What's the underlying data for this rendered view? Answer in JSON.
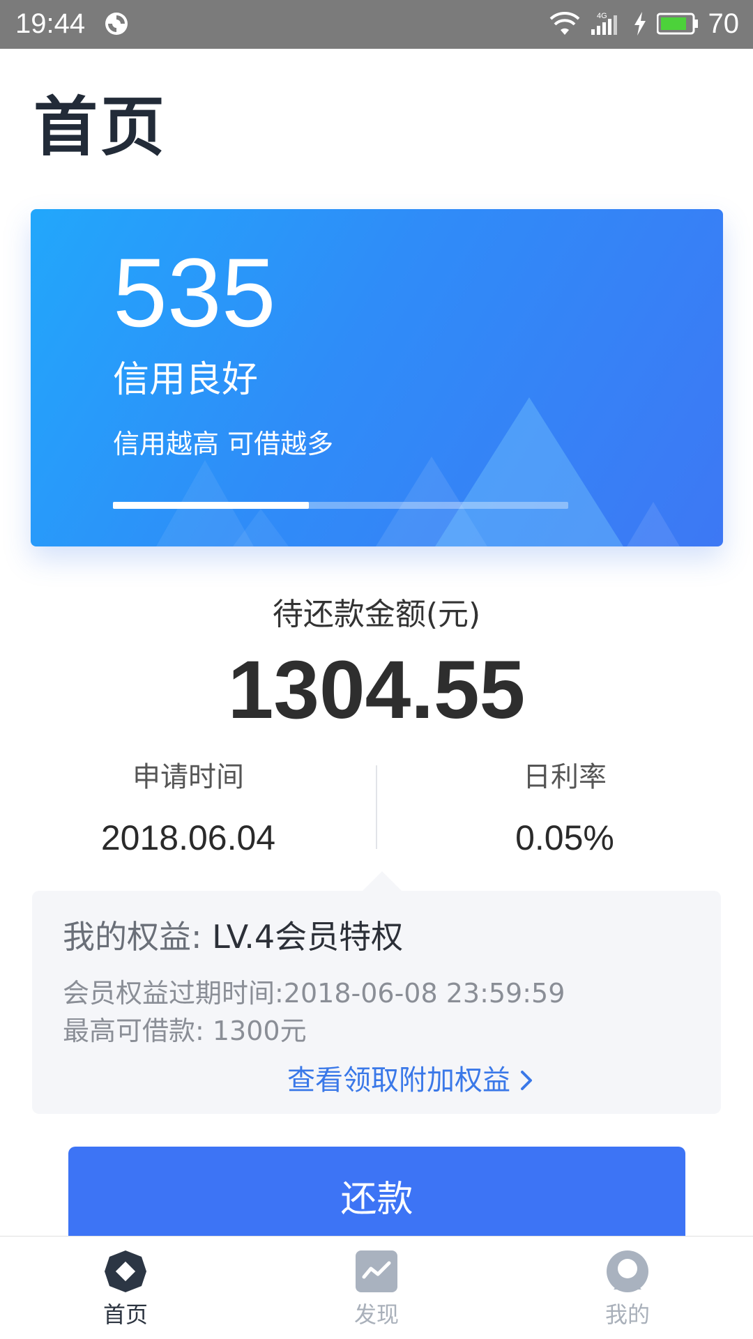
{
  "status_bar": {
    "time": "19:44",
    "network": "4G",
    "battery": "70",
    "icons": [
      "sync-icon",
      "wifi-icon",
      "signal-icon",
      "charging-icon",
      "battery-icon"
    ]
  },
  "page": {
    "title": "首页"
  },
  "credit": {
    "score": "535",
    "level": "信用良好",
    "tip": "信用越高 可借越多",
    "progress_fraction": 0.43
  },
  "repayment": {
    "label": "待还款金额(元)",
    "amount": "1304.55",
    "apply_time_label": "申请时间",
    "apply_time": "2018.06.04",
    "daily_rate_label": "日利率",
    "daily_rate": "0.05%"
  },
  "benefits": {
    "title_key": "我的权益:",
    "title_value": "LV.4会员特权",
    "expiry": "会员权益过期时间:2018-06-08 23:59:59",
    "max_loan": "最高可借款: 1300元",
    "link": "查看领取附加权益"
  },
  "actions": {
    "repay": "还款"
  },
  "tabbar": {
    "items": [
      {
        "label": "首页",
        "icon": "home-icon",
        "active": true
      },
      {
        "label": "发现",
        "icon": "discover-icon",
        "active": false
      },
      {
        "label": "我的",
        "icon": "profile-icon",
        "active": false
      }
    ]
  },
  "colors": {
    "accent": "#3d74f5",
    "card_gradient_start": "#22a7fb",
    "card_gradient_end": "#3d78f4",
    "link": "#3a78e8",
    "status_bar": "#7b7b7b"
  }
}
